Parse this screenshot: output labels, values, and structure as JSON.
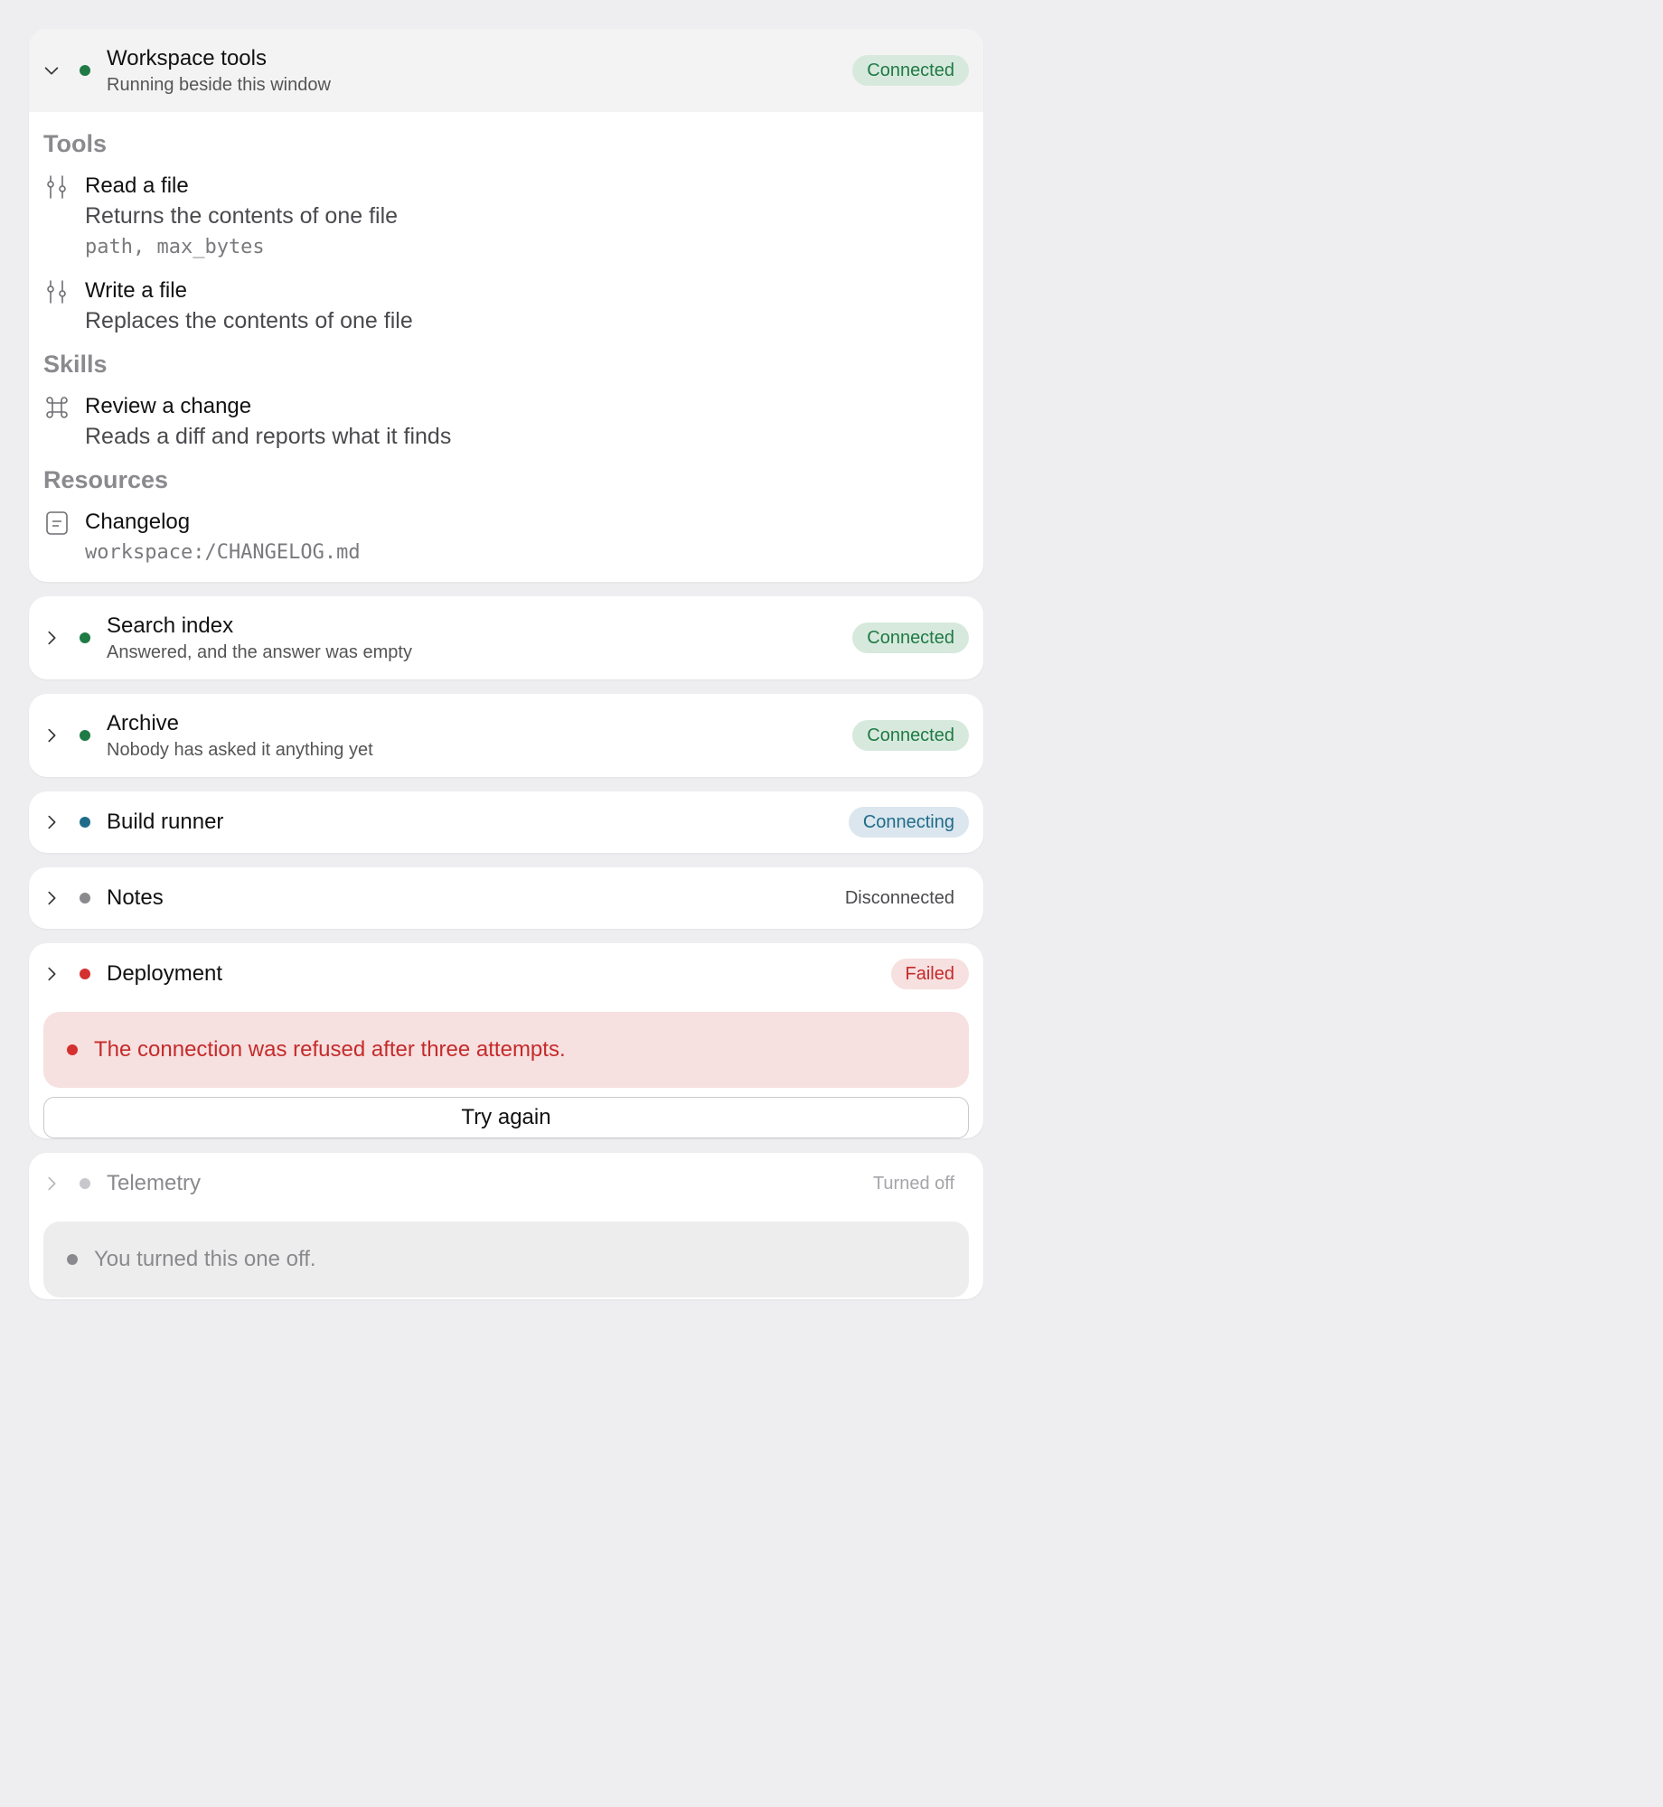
{
  "colors": {
    "connected_dot": "#1f7a45",
    "connected_badge_bg": "#d7e9dd",
    "connected_badge_text": "#1f7a45",
    "connecting_dot": "#1f6c8a",
    "connecting_badge_bg": "#dbe6ee",
    "connecting_badge_text": "#1f6c8a",
    "disconnected_dot": "#8a8a8e",
    "failed_dot": "#d3302f",
    "failed_badge_bg": "#f7e0e0",
    "failed_badge_text": "#c42b2a",
    "off_dot": "#c8c8cc"
  },
  "servers": [
    {
      "name": "Workspace tools",
      "subtitle": "Running beside this window",
      "status": "Connected",
      "expanded": true,
      "sections": {
        "tools_label": "Tools",
        "tools": [
          {
            "icon": "sliders-icon",
            "title": "Read a file",
            "description": "Returns the contents of one file",
            "params": "path, max_bytes"
          },
          {
            "icon": "sliders-icon",
            "title": "Write a file",
            "description": "Replaces the contents of one file"
          }
        ],
        "skills_label": "Skills",
        "skills": [
          {
            "icon": "command-icon",
            "title": "Review a change",
            "description": "Reads a diff and reports what it finds"
          }
        ],
        "resources_label": "Resources",
        "resources": [
          {
            "icon": "document-icon",
            "title": "Changelog",
            "uri": "workspace:/CHANGELOG.md"
          }
        ]
      }
    },
    {
      "name": "Search index",
      "subtitle": "Answered, and the answer was empty",
      "status": "Connected"
    },
    {
      "name": "Archive",
      "subtitle": "Nobody has asked it anything yet",
      "status": "Connected"
    },
    {
      "name": "Build runner",
      "status": "Connecting"
    },
    {
      "name": "Notes",
      "status": "Disconnected"
    },
    {
      "name": "Deployment",
      "status": "Failed",
      "error": "The connection was refused after three attempts.",
      "retry_label": "Try again"
    },
    {
      "name": "Telemetry",
      "status": "Turned off",
      "notice": "You turned this one off."
    }
  ]
}
